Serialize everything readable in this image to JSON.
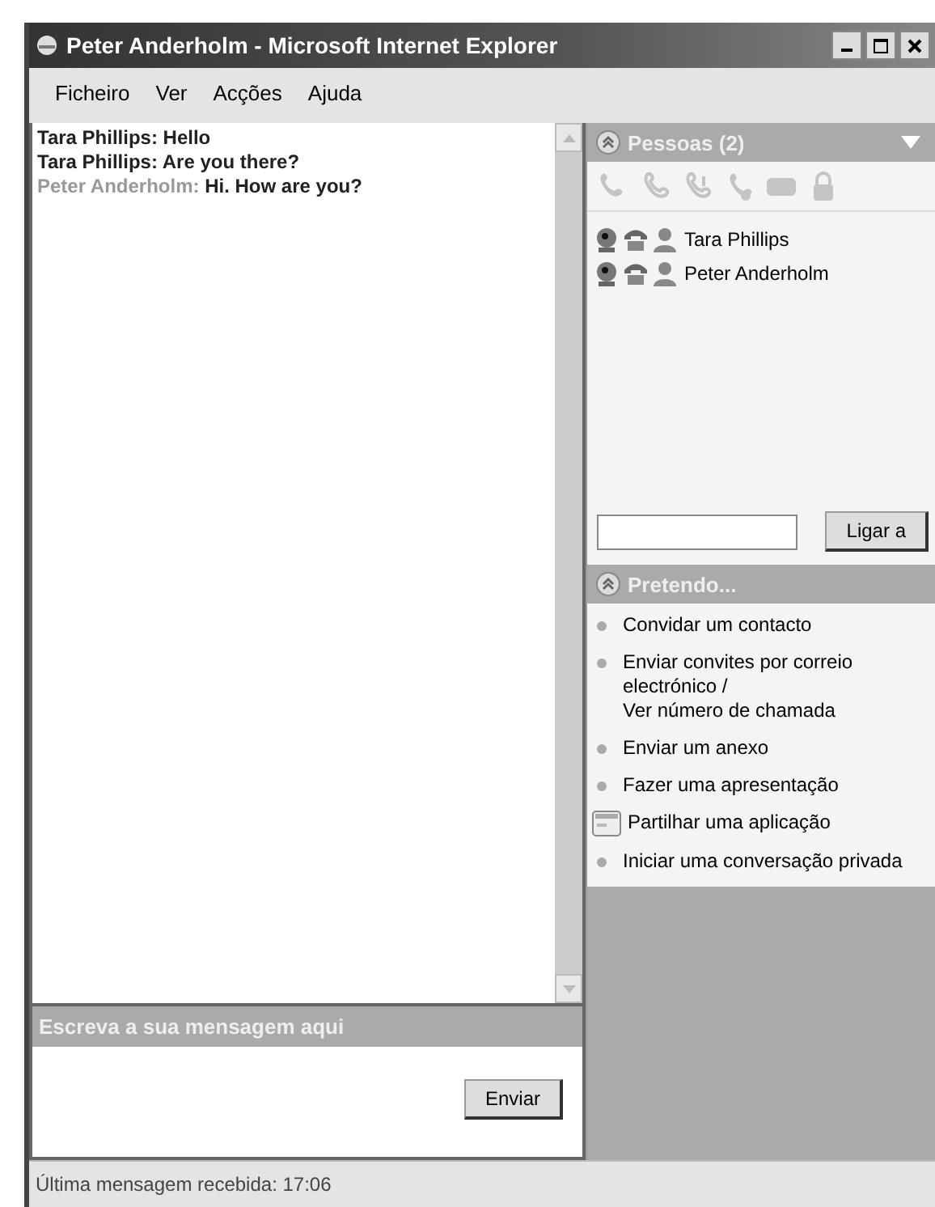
{
  "window": {
    "title": "Peter Anderholm - Microsoft Internet Explorer"
  },
  "menu": [
    "Ficheiro",
    "Ver",
    "Acções",
    "Ajuda"
  ],
  "messages": [
    {
      "sender": "Tara Phillips:",
      "text": "Hello",
      "own": false
    },
    {
      "sender": "Tara Phillips:",
      "text": "Are you there?",
      "own": false
    },
    {
      "sender": "Peter Anderholm:",
      "text": "Hi. How are you?",
      "own": true
    }
  ],
  "compose": {
    "title": "Escreva a sua mensagem aqui",
    "send_button": "Enviar"
  },
  "people": {
    "title": "Pessoas (2)",
    "contacts": [
      "Tara Phillips",
      "Peter Anderholm"
    ],
    "call_button": "Ligar a"
  },
  "actions": {
    "title": "Pretendo...",
    "items": [
      {
        "kind": "bullet",
        "label": "Convidar um contacto"
      },
      {
        "kind": "bullet",
        "label": "Enviar convites por correio electrónico /\nVer número de chamada"
      },
      {
        "kind": "bullet",
        "label": "Enviar um anexo"
      },
      {
        "kind": "bullet",
        "label": "Fazer uma apresentação"
      },
      {
        "kind": "app",
        "label": "Partilhar uma aplicação"
      },
      {
        "kind": "bullet",
        "label": "Iniciar uma conversação privada"
      }
    ]
  },
  "status_bar": "Última mensagem recebida: 17:06"
}
